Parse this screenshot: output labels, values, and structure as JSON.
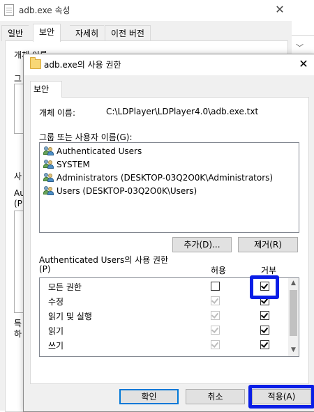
{
  "background_window": {
    "title": "adb.exe 속성",
    "tabs": [
      "일반",
      "보안",
      "자세히",
      "이전 버전"
    ],
    "partial_texts": [
      {
        "text": "개체 이름"
      },
      {
        "text": "그"
      },
      {
        "text": "사"
      },
      {
        "text": "Au"
      },
      {
        "text": "(P"
      },
      {
        "text": "특"
      },
      {
        "text": "하"
      }
    ]
  },
  "dialog": {
    "title": "adb.exe의 사용 권한",
    "tab": "보안",
    "object_name_label": "개체 이름:",
    "object_path": "C:\\LDPlayer\\LDPlayer4.0\\adb.exe.txt",
    "group_label": "그룹 또는 사용자 이름(G):",
    "users": [
      "Authenticated Users",
      "SYSTEM",
      "Administrators (DESKTOP-03Q2O0K\\Administrators)",
      "Users (DESKTOP-03Q2O0K\\Users)"
    ],
    "add_button": "추가(D)...",
    "remove_button": "제거(R)",
    "permissions_label_line1": "Authenticated Users의 사용 권한",
    "permissions_label_line2": "(P)",
    "allow_header": "허용",
    "deny_header": "거부",
    "permissions": [
      {
        "name": "모든 권한",
        "allow": false,
        "allow_disabled": false,
        "deny": true,
        "deny_disabled": false
      },
      {
        "name": "수정",
        "allow": true,
        "allow_disabled": true,
        "deny": true,
        "deny_disabled": false
      },
      {
        "name": "읽기 및 실행",
        "allow": true,
        "allow_disabled": true,
        "deny": true,
        "deny_disabled": false
      },
      {
        "name": "읽기",
        "allow": true,
        "allow_disabled": true,
        "deny": true,
        "deny_disabled": false
      },
      {
        "name": "쓰기",
        "allow": true,
        "allow_disabled": true,
        "deny": true,
        "deny_disabled": false
      }
    ],
    "ok_button": "확인",
    "cancel_button": "취소",
    "apply_button": "적용(A)"
  },
  "colors": {
    "highlight": "#0a1ee6",
    "window_bg": "#f0f0f0",
    "button_bg": "#e1e1e1",
    "default_button_border": "#0078d7"
  }
}
